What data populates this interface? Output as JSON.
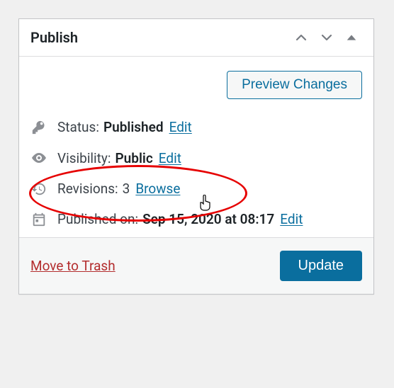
{
  "panel": {
    "title": "Publish",
    "preview_label": "Preview Changes",
    "status": {
      "label": "Status:",
      "value": "Published",
      "edit": "Edit"
    },
    "visibility": {
      "label": "Visibility:",
      "value": "Public",
      "edit": "Edit"
    },
    "revisions": {
      "label": "Revisions:",
      "value": "3",
      "browse": "Browse"
    },
    "published": {
      "label": "Published on:",
      "value": "Sep 15, 2020 at 08:17",
      "edit": "Edit"
    },
    "trash": "Move to Trash",
    "update": "Update"
  }
}
